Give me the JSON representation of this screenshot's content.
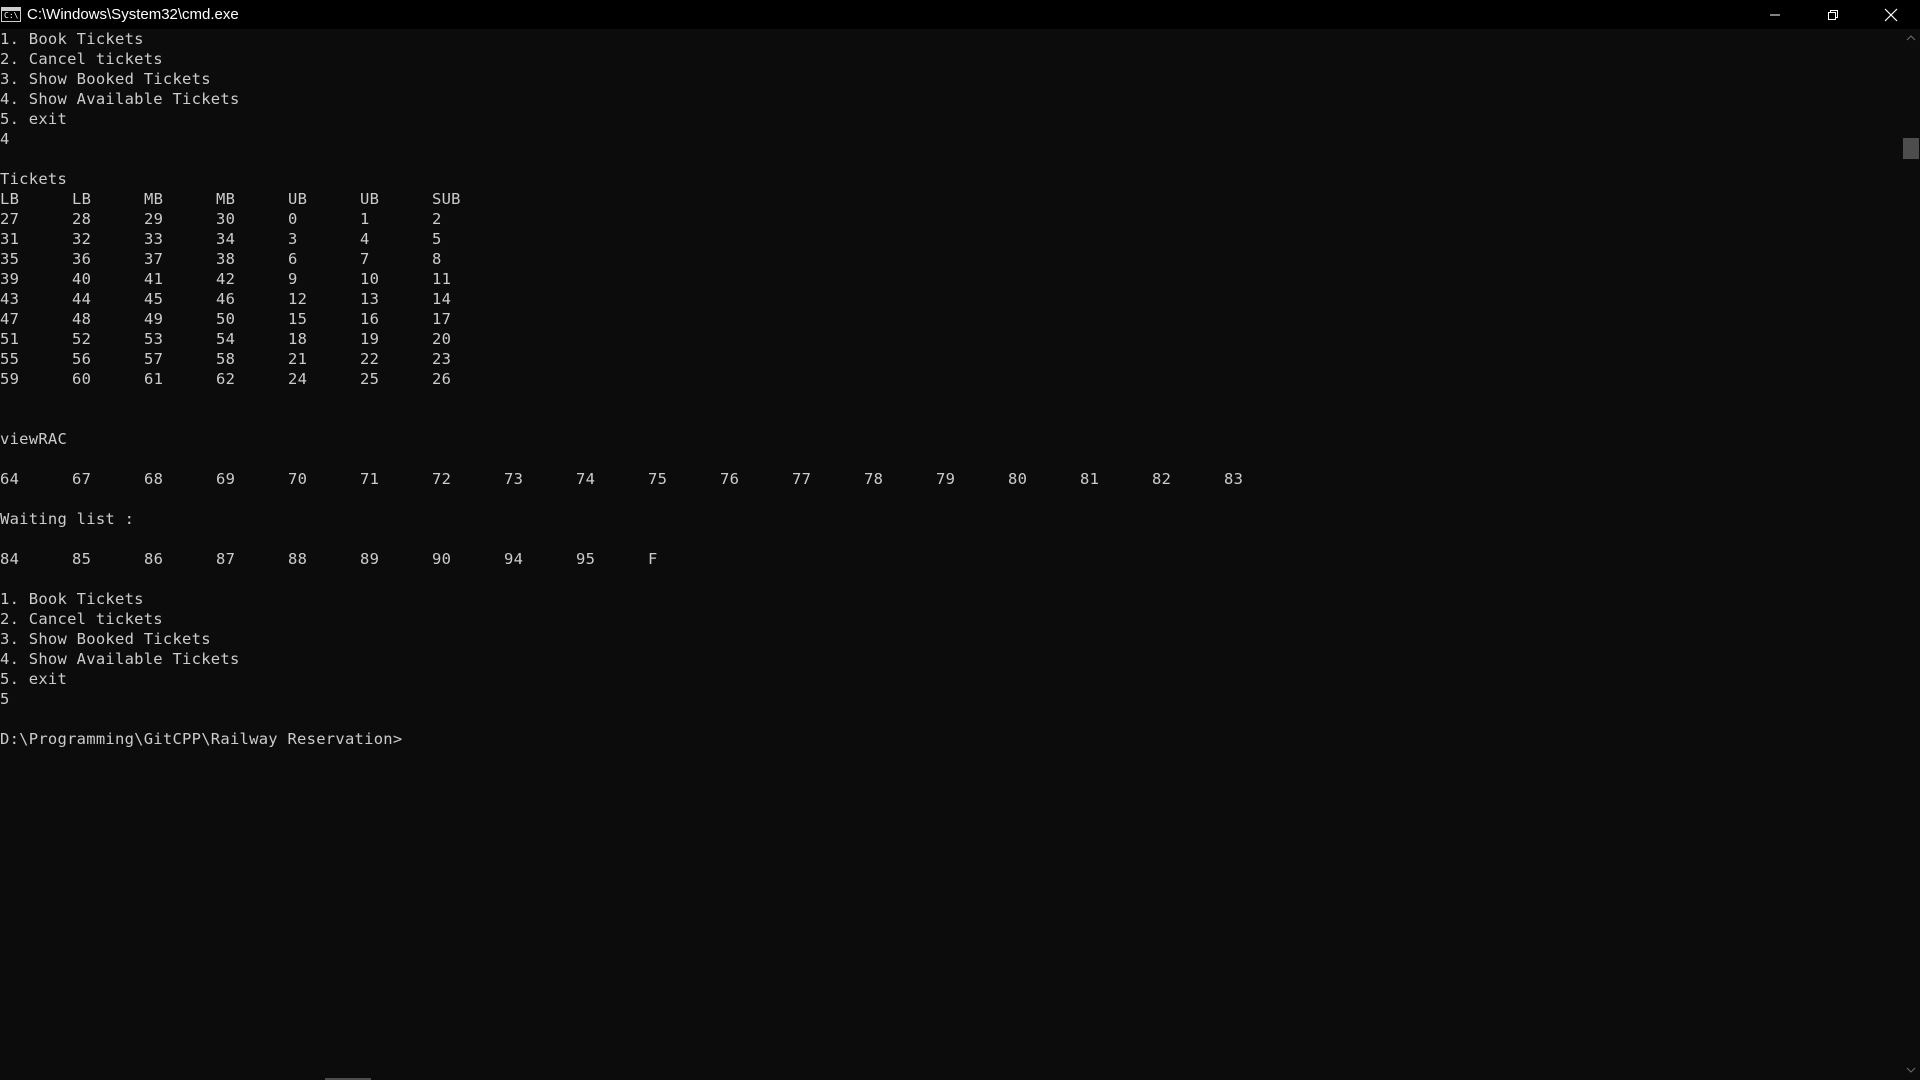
{
  "window": {
    "title": "C:\\Windows\\System32\\cmd.exe",
    "icon_label": "C:\\",
    "controls": [
      "minimize-icon",
      "restore-icon",
      "close-icon"
    ]
  },
  "colors": {
    "background": "#0c0c0c",
    "text": "#cccccc",
    "titlebar": "#000000"
  },
  "console": {
    "menu1": [
      "1. Book Tickets",
      "2. Cancel tickets",
      "3. Show Booked Tickets",
      "4. Show Available Tickets",
      "5. exit"
    ],
    "input1": "4",
    "tickets_label": "Tickets",
    "tickets_headers": [
      "LB",
      "LB",
      "MB",
      "MB",
      "UB",
      "UB",
      "SUB"
    ],
    "tickets_rows": [
      [
        "27",
        "28",
        "29",
        "30",
        "0",
        "1",
        "2"
      ],
      [
        "31",
        "32",
        "33",
        "34",
        "3",
        "4",
        "5"
      ],
      [
        "35",
        "36",
        "37",
        "38",
        "6",
        "7",
        "8"
      ],
      [
        "39",
        "40",
        "41",
        "42",
        "9",
        "10",
        "11"
      ],
      [
        "43",
        "44",
        "45",
        "46",
        "12",
        "13",
        "14"
      ],
      [
        "47",
        "48",
        "49",
        "50",
        "15",
        "16",
        "17"
      ],
      [
        "51",
        "52",
        "53",
        "54",
        "18",
        "19",
        "20"
      ],
      [
        "55",
        "56",
        "57",
        "58",
        "21",
        "22",
        "23"
      ],
      [
        "59",
        "60",
        "61",
        "62",
        "24",
        "25",
        "26"
      ]
    ],
    "rac_label": "viewRAC",
    "rac_values": [
      "64",
      "67",
      "68",
      "69",
      "70",
      "71",
      "72",
      "73",
      "74",
      "75",
      "76",
      "77",
      "78",
      "79",
      "80",
      "81",
      "82",
      "83"
    ],
    "waiting_label": "Waiting list :",
    "waiting_values": [
      "84",
      "85",
      "86",
      "87",
      "88",
      "89",
      "90",
      "94",
      "95",
      "F"
    ],
    "menu2": [
      "1. Book Tickets",
      "2. Cancel tickets",
      "3. Show Booked Tickets",
      "4. Show Available Tickets",
      "5. exit"
    ],
    "input2": "5",
    "prompt": "D:\\Programming\\GitCPP\\Railway Reservation>"
  }
}
